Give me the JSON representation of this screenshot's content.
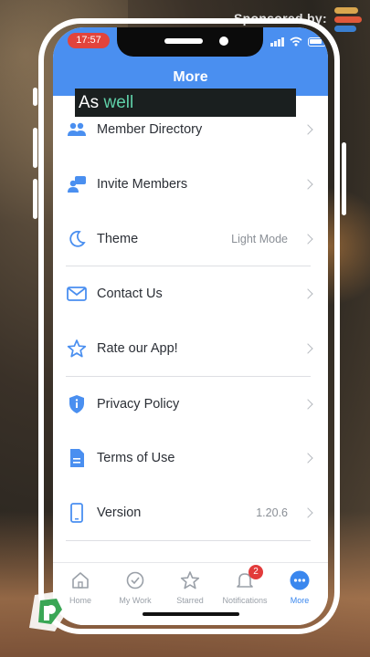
{
  "overlay": {
    "sponsored_label": "Sponsored by:",
    "caption_prefix": "As",
    "caption_highlight": "well"
  },
  "status_bar": {
    "time": "17:57"
  },
  "header": {
    "title": "More"
  },
  "menu": {
    "items": [
      {
        "label": "Member Directory",
        "icon": "people-icon"
      },
      {
        "label": "Invite Members",
        "icon": "invite-icon"
      },
      {
        "label": "Theme",
        "value": "Light Mode",
        "icon": "moon-icon"
      },
      {
        "label": "Contact Us",
        "icon": "mail-icon"
      },
      {
        "label": "Rate our App!",
        "icon": "star-icon"
      },
      {
        "label": "Privacy Policy",
        "icon": "shield-icon"
      },
      {
        "label": "Terms of Use",
        "icon": "document-icon"
      },
      {
        "label": "Version",
        "value": "1.20.6",
        "icon": "phone-icon"
      }
    ]
  },
  "tabbar": {
    "tabs": [
      {
        "label": "Home",
        "icon": "home-icon"
      },
      {
        "label": "My Work",
        "icon": "check-circle-icon"
      },
      {
        "label": "Starred",
        "icon": "star-icon"
      },
      {
        "label": "Notifications",
        "icon": "bell-icon",
        "badge": "2"
      },
      {
        "label": "More",
        "icon": "more-icon"
      }
    ],
    "active": "More"
  },
  "colors": {
    "header_blue": "#4a8ff0",
    "accent": "#3a87ee",
    "time_pill": "#e2443c",
    "caption_highlight": "#5fd0a8"
  }
}
